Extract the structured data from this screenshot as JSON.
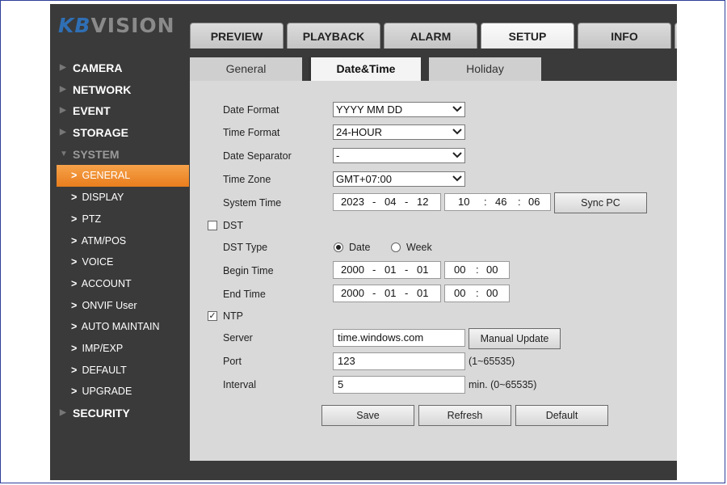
{
  "brand": {
    "logo_kb": "KB",
    "logo_rest": "VISION"
  },
  "top_tabs": [
    {
      "label": "PREVIEW"
    },
    {
      "label": "PLAYBACK"
    },
    {
      "label": "ALARM"
    },
    {
      "label": "SETUP",
      "active": true
    },
    {
      "label": "INFO"
    }
  ],
  "sidebar": {
    "sections": {
      "camera": "CAMERA",
      "network": "NETWORK",
      "event": "EVENT",
      "storage": "STORAGE",
      "system": "SYSTEM",
      "security": "SECURITY"
    },
    "system_items": [
      {
        "label": "GENERAL",
        "active": true
      },
      {
        "label": "DISPLAY"
      },
      {
        "label": "PTZ"
      },
      {
        "label": "ATM/POS"
      },
      {
        "label": "VOICE"
      },
      {
        "label": "ACCOUNT"
      },
      {
        "label": "ONVIF User"
      },
      {
        "label": "AUTO MAINTAIN"
      },
      {
        "label": "IMP/EXP"
      },
      {
        "label": "DEFAULT"
      },
      {
        "label": "UPGRADE"
      }
    ]
  },
  "sub_tabs": [
    {
      "label": "General"
    },
    {
      "label": "Date&Time",
      "active": true
    },
    {
      "label": "Holiday"
    }
  ],
  "form": {
    "date_format": {
      "label": "Date Format",
      "value": "YYYY MM DD"
    },
    "time_format": {
      "label": "Time Format",
      "value": "24-HOUR"
    },
    "date_separator": {
      "label": "Date Separator",
      "value": "-"
    },
    "time_zone": {
      "label": "Time Zone",
      "value": "GMT+07:00"
    },
    "system_time": {
      "label": "System Time",
      "year": "2023",
      "month": "04",
      "day": "12",
      "hour": "10",
      "minute": "46",
      "second": "06",
      "sync_label": "Sync PC"
    },
    "dst": {
      "label": "DST",
      "checked": false
    },
    "dst_type": {
      "label": "DST Type",
      "option_date": "Date",
      "option_week": "Week",
      "selected": "Date"
    },
    "begin_time": {
      "label": "Begin Time",
      "year": "2000",
      "month": "01",
      "day": "01",
      "hour": "00",
      "minute": "00"
    },
    "end_time": {
      "label": "End Time",
      "year": "2000",
      "month": "01",
      "day": "01",
      "hour": "00",
      "minute": "00"
    },
    "ntp": {
      "label": "NTP",
      "checked": true
    },
    "server": {
      "label": "Server",
      "value": "time.windows.com",
      "update_label": "Manual Update"
    },
    "port": {
      "label": "Port",
      "value": "123",
      "hint": "(1~65535)"
    },
    "interval": {
      "label": "Interval",
      "value": "5",
      "hint": "min. (0~65535)"
    },
    "sep": {
      "dash": "-",
      "colon": ":"
    }
  },
  "buttons": {
    "save": "Save",
    "refresh": "Refresh",
    "default": "Default"
  },
  "colors": {
    "accent": "#e97d1d",
    "sidebar_bg": "#3a3a3a",
    "content_bg": "#d9d9d9"
  }
}
